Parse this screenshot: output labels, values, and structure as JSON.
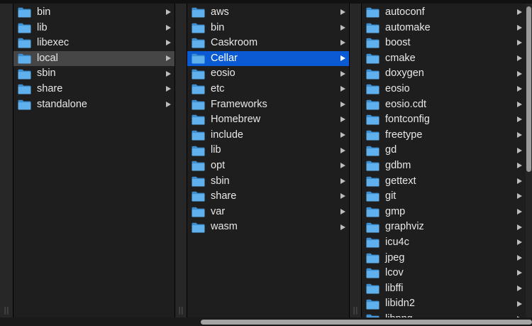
{
  "columns": [
    {
      "id": "usr",
      "items": [
        {
          "label": "bin",
          "state": ""
        },
        {
          "label": "lib",
          "state": ""
        },
        {
          "label": "libexec",
          "state": ""
        },
        {
          "label": "local",
          "state": "parent"
        },
        {
          "label": "sbin",
          "state": ""
        },
        {
          "label": "share",
          "state": ""
        },
        {
          "label": "standalone",
          "state": ""
        }
      ]
    },
    {
      "id": "local",
      "items": [
        {
          "label": "aws",
          "state": ""
        },
        {
          "label": "bin",
          "state": ""
        },
        {
          "label": "Caskroom",
          "state": ""
        },
        {
          "label": "Cellar",
          "state": "selected"
        },
        {
          "label": "eosio",
          "state": ""
        },
        {
          "label": "etc",
          "state": ""
        },
        {
          "label": "Frameworks",
          "state": ""
        },
        {
          "label": "Homebrew",
          "state": ""
        },
        {
          "label": "include",
          "state": ""
        },
        {
          "label": "lib",
          "state": ""
        },
        {
          "label": "opt",
          "state": ""
        },
        {
          "label": "sbin",
          "state": ""
        },
        {
          "label": "share",
          "state": ""
        },
        {
          "label": "var",
          "state": ""
        },
        {
          "label": "wasm",
          "state": ""
        }
      ]
    },
    {
      "id": "cellar",
      "items": [
        {
          "label": "autoconf",
          "state": ""
        },
        {
          "label": "automake",
          "state": ""
        },
        {
          "label": "boost",
          "state": ""
        },
        {
          "label": "cmake",
          "state": ""
        },
        {
          "label": "doxygen",
          "state": ""
        },
        {
          "label": "eosio",
          "state": ""
        },
        {
          "label": "eosio.cdt",
          "state": ""
        },
        {
          "label": "fontconfig",
          "state": ""
        },
        {
          "label": "freetype",
          "state": ""
        },
        {
          "label": "gd",
          "state": ""
        },
        {
          "label": "gdbm",
          "state": ""
        },
        {
          "label": "gettext",
          "state": ""
        },
        {
          "label": "git",
          "state": ""
        },
        {
          "label": "gmp",
          "state": ""
        },
        {
          "label": "graphviz",
          "state": ""
        },
        {
          "label": "icu4c",
          "state": ""
        },
        {
          "label": "jpeg",
          "state": ""
        },
        {
          "label": "lcov",
          "state": ""
        },
        {
          "label": "libffi",
          "state": ""
        },
        {
          "label": "libidn2",
          "state": ""
        },
        {
          "label": "libpng",
          "state": ""
        }
      ]
    }
  ],
  "icons": {
    "folder": "folder-icon",
    "disclosure": "chevron-right-icon",
    "resize_handle": "column-resize-handle-icon"
  },
  "colors": {
    "background": "#1e1e1e",
    "selection": "#0a5ad3",
    "parent_highlight": "#464646",
    "folder_back": "#3d8fd1",
    "folder_front": "#5fb0ec"
  }
}
